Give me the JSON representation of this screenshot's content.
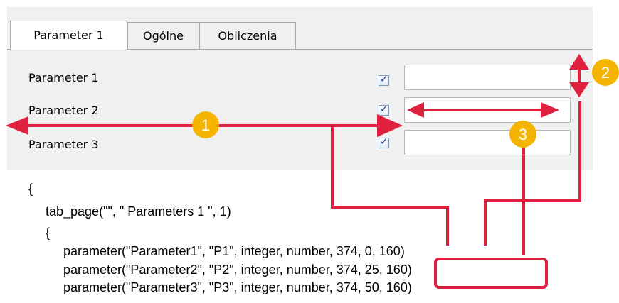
{
  "tabs": [
    {
      "label": "Parameter 1",
      "active": true
    },
    {
      "label": "Ogólne",
      "active": false
    },
    {
      "label": "Obliczenia",
      "active": false
    }
  ],
  "form": {
    "rows": [
      {
        "label": "Parameter 1",
        "checked": true,
        "value": ""
      },
      {
        "label": "Parameter 2",
        "checked": true,
        "value": ""
      },
      {
        "label": "Parameter 3",
        "checked": true,
        "value": ""
      }
    ],
    "check_glyph": "✓"
  },
  "code": {
    "lines": [
      "{",
      "tab_page(\"\", \" Parameters 1 \", 1)",
      "{",
      "parameter(\"Parameter1\", \"P1\", integer, number, 374, 0, 160)",
      "parameter(\"Parameter2\", \"P2\", integer, number, 374, 25, 160)",
      "parameter(\"Parameter3\", \"P3\", integer, number, 374, 50, 160)"
    ]
  },
  "annotations": {
    "badges": [
      "1",
      "2",
      "3"
    ],
    "arrow_color": "#e0203f",
    "badge_color": "#f5b400"
  }
}
